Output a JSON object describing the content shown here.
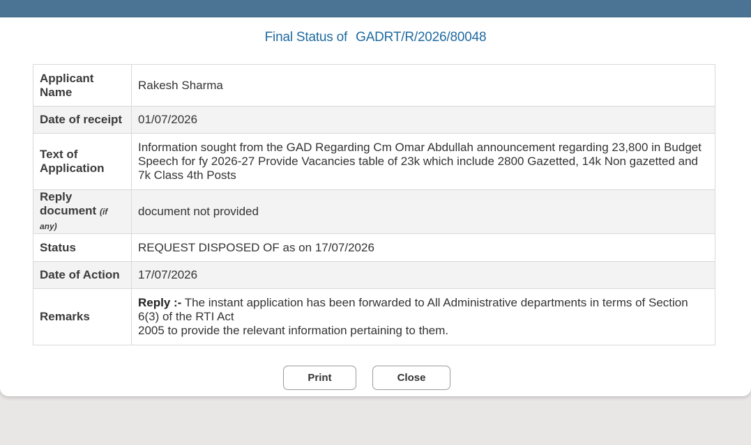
{
  "dialog": {
    "title_prefix": "Final Status of",
    "request_id": "GADRT/R/2026/80048"
  },
  "rows": {
    "applicant_name": {
      "label": "Applicant Name",
      "value": "Rakesh Sharma"
    },
    "date_of_receipt": {
      "label": "Date of receipt",
      "value": "01/07/2026"
    },
    "text_of_application": {
      "label": "Text of Application",
      "value": "Information sought from the GAD Regarding Cm Omar Abdullah announcement regarding 23,800 in Budget Speech for fy 2026-27 Provide Vacancies table of 23k which include 2800 Gazetted, 14k Non gazetted and 7k Class 4th Posts"
    },
    "reply_document": {
      "label": "Reply document",
      "label_note": "(if any)",
      "value": "document not provided"
    },
    "status": {
      "label": "Status",
      "value": "REQUEST DISPOSED OF as on 17/07/2026"
    },
    "date_of_action": {
      "label": "Date of Action",
      "value": "17/07/2026"
    },
    "remarks": {
      "label": "Remarks",
      "reply_prefix": "Reply :-",
      "line1": "The instant application has been forwarded to All Administrative departments in terms of Section 6(3) of the RTI Act",
      "line2": "2005 to provide the relevant information pertaining to them."
    }
  },
  "buttons": {
    "print": "Print",
    "close": "Close"
  }
}
